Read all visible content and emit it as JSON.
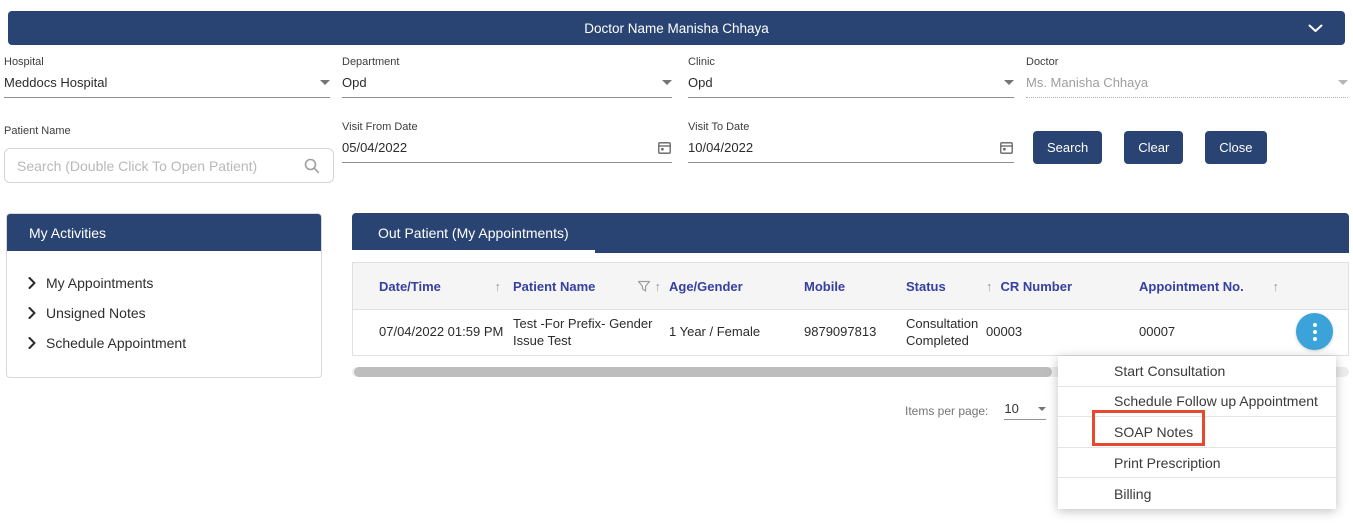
{
  "header": {
    "title": "Doctor Name Manisha Chhaya"
  },
  "filters": {
    "hospital": {
      "label": "Hospital",
      "value": "Meddocs Hospital"
    },
    "department": {
      "label": "Department",
      "value": "Opd"
    },
    "clinic": {
      "label": "Clinic",
      "value": "Opd"
    },
    "doctor": {
      "label": "Doctor",
      "value": "Ms. Manisha Chhaya"
    },
    "patient_name": {
      "label": "Patient Name",
      "placeholder": "Search (Double Click To Open Patient)"
    },
    "visit_from": {
      "label": "Visit From Date",
      "value": "05/04/2022"
    },
    "visit_to": {
      "label": "Visit To Date",
      "value": "10/04/2022"
    },
    "buttons": {
      "search": "Search",
      "clear": "Clear",
      "close": "Close"
    }
  },
  "sidebar": {
    "title": "My Activities",
    "items": [
      "My Appointments",
      "Unsigned Notes",
      "Schedule Appointment"
    ]
  },
  "main": {
    "tab": "Out Patient (My Appointments)",
    "table": {
      "columns": [
        "Date/Time",
        "Patient Name",
        "Age/Gender",
        "Mobile",
        "Status",
        "CR Number",
        "Appointment No."
      ],
      "rows": [
        [
          "07/04/2022 01:59 PM",
          "Test -For Prefix- Gender Issue Test",
          "1 Year / Female",
          "9879097813",
          "Consultation Completed",
          "00003",
          "00007"
        ]
      ]
    },
    "paginator": {
      "label": "Items per page:",
      "value": "10"
    }
  },
  "menu": {
    "items": [
      "Start Consultation",
      "Schedule Follow up Appointment",
      "SOAP Notes",
      "Print Prescription",
      "Billing"
    ],
    "highlighted": "SOAP Notes"
  },
  "colors": {
    "navy": "#294372",
    "accent_blue": "#3BA3DA",
    "highlight_red": "#E8492E",
    "table_header_text": "#3540A0"
  }
}
